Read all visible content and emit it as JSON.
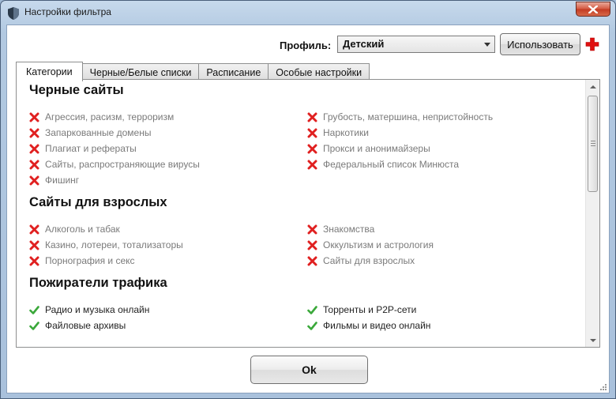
{
  "window": {
    "title": "Настройки фильтра"
  },
  "profile": {
    "label": "Профиль:",
    "selected": "Детский",
    "use_label": "Использовать"
  },
  "tabs": [
    {
      "label": "Категории",
      "active": true
    },
    {
      "label": "Черные/Белые списки",
      "active": false
    },
    {
      "label": "Расписание",
      "active": false
    },
    {
      "label": "Особые настройки",
      "active": false
    }
  ],
  "sections": [
    {
      "title": "Черные сайты",
      "left": [
        "Агрессия, расизм, терроризм",
        "Запаркованные домены",
        "Плагиат и рефераты",
        "Сайты, распространяющие вирусы",
        "Фишинг"
      ],
      "right": [
        "Грубость, матершина, непристойность",
        "Наркотики",
        "Прокси и анонимайзеры",
        "Федеральный список Минюста"
      ],
      "state": "blocked"
    },
    {
      "title": "Сайты для взрослых",
      "left": [
        "Алкоголь и табак",
        "Казино, лотереи, тотализаторы",
        "Порнография и секс"
      ],
      "right": [
        "Знакомства",
        "Оккультизм и астрология",
        "Сайты для взрослых"
      ],
      "state": "blocked"
    },
    {
      "title": "Пожиратели трафика",
      "left": [
        "Радио и музыка онлайн",
        "Файловые архивы"
      ],
      "right": [
        "Торренты и P2P-сети",
        "Фильмы и видео онлайн"
      ],
      "state": "allowed"
    }
  ],
  "footer": {
    "ok_label": "Ok"
  },
  "icons": {
    "blocked": "red-x-icon",
    "allowed": "green-check-icon",
    "add": "red-plus-icon",
    "close": "close-icon",
    "app": "shield-icon"
  },
  "colors": {
    "blocked": "#e02020",
    "allowed": "#3aa83a",
    "close_button": "#c9452c",
    "add": "#e01010"
  }
}
